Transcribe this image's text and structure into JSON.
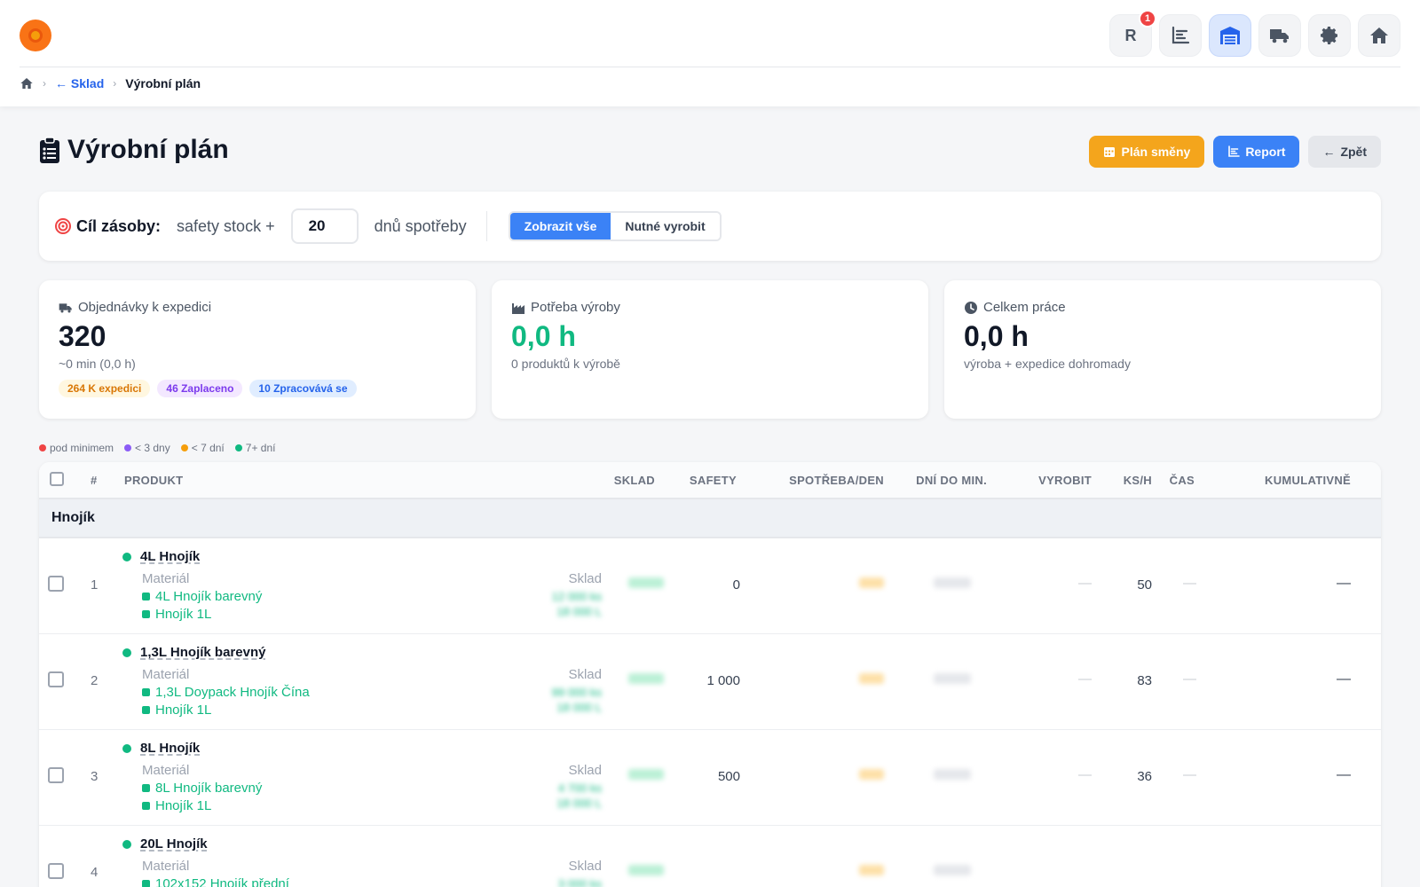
{
  "nav": {
    "user_initial": "R",
    "notification_count": "1",
    "icons": [
      "chart-icon",
      "warehouse-icon",
      "truck-icon",
      "gear-icon",
      "home-icon"
    ]
  },
  "breadcrumb": {
    "back": "Sklad",
    "current": "Výrobní plán"
  },
  "header": {
    "title": "Výrobní plán",
    "btn_plan": "Plán směny",
    "btn_report": "Report",
    "btn_back": "Zpět"
  },
  "target": {
    "label": "Cíl zásoby:",
    "prefix": "safety stock +",
    "days": "20",
    "suffix": "dnů spotřeby",
    "toggle_all": "Zobrazit vše",
    "toggle_needed": "Nutné vyrobit"
  },
  "stats": {
    "orders": {
      "title": "Objednávky k expedici",
      "value": "320",
      "sub": "~0 min (0,0 h)",
      "chip1": "264 K expedici",
      "chip2": "46 Zaplaceno",
      "chip3": "10 Zpracovává se"
    },
    "need": {
      "title": "Potřeba výroby",
      "value": "0,0 h",
      "sub": "0 produktů k výrobě"
    },
    "total": {
      "title": "Celkem práce",
      "value": "0,0 h",
      "sub": "výroba + expedice dohromady"
    }
  },
  "legend": {
    "red": "pod minimem",
    "purple": "< 3 dny",
    "yellow": "< 7 dní",
    "green": "7+ dní"
  },
  "colors": {
    "accent": "#3b82f6",
    "orange": "#f4a51c",
    "green": "#10b981",
    "red": "#ef4444",
    "purple": "#8b5cf6",
    "yellow": "#f59e0b"
  },
  "table": {
    "headers": {
      "num": "#",
      "product": "PRODUKT",
      "stock": "SKLAD",
      "safety": "SAFETY",
      "consumption": "SPOTŘEBA/DEN",
      "days": "DNÍ DO MIN.",
      "produce": "VYROBIT",
      "rate": "KS/H",
      "time": "ČAS",
      "cumulative": "KUMULATIVNĚ"
    },
    "group": "Hnojík",
    "material_label": "Materiál",
    "stock_label": "Sklad",
    "dash": "—",
    "rows": [
      {
        "index": "1",
        "name": "4L Hnojík",
        "materials": [
          "4L Hnojík barevný",
          "Hnojík 1L"
        ],
        "safety": "0",
        "rate": "50"
      },
      {
        "index": "2",
        "name": "1,3L Hnojík barevný",
        "materials": [
          "1,3L Doypack Hnojík Čína",
          "Hnojík 1L"
        ],
        "safety": "1 000",
        "rate": "83"
      },
      {
        "index": "3",
        "name": "8L Hnojík",
        "materials": [
          "8L Hnojík barevný",
          "Hnojík 1L"
        ],
        "safety": "500",
        "rate": "36"
      },
      {
        "index": "4",
        "name": "20L Hnojík",
        "materials": [
          "102x152 Hnojík přední"
        ],
        "safety": "",
        "rate": ""
      }
    ]
  }
}
